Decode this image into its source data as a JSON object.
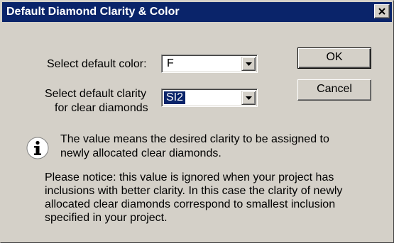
{
  "window": {
    "title": "Default Diamond Clarity & Color"
  },
  "color_field": {
    "label": "Select default color:",
    "value": "F"
  },
  "clarity_field": {
    "label_line1": "Select default clarity",
    "label_line2": "for clear diamonds",
    "value": "SI2"
  },
  "buttons": {
    "ok": "OK",
    "cancel": "Cancel"
  },
  "info": {
    "line1": "The value means the desired clarity to be assigned to",
    "line2": "newly allocated clear diamonds."
  },
  "notice": {
    "line1": "Please notice: this value is ignored when your project has",
    "line2": "inclusions with better clarity.  In this case the clarity of newly",
    "line3": "allocated clear diamonds correspond to smallest inclusion",
    "line4": "specified in your project."
  },
  "colors": {
    "titlebar": "#0a246a",
    "face": "#d4d0c8",
    "selection": "#0a246a"
  }
}
